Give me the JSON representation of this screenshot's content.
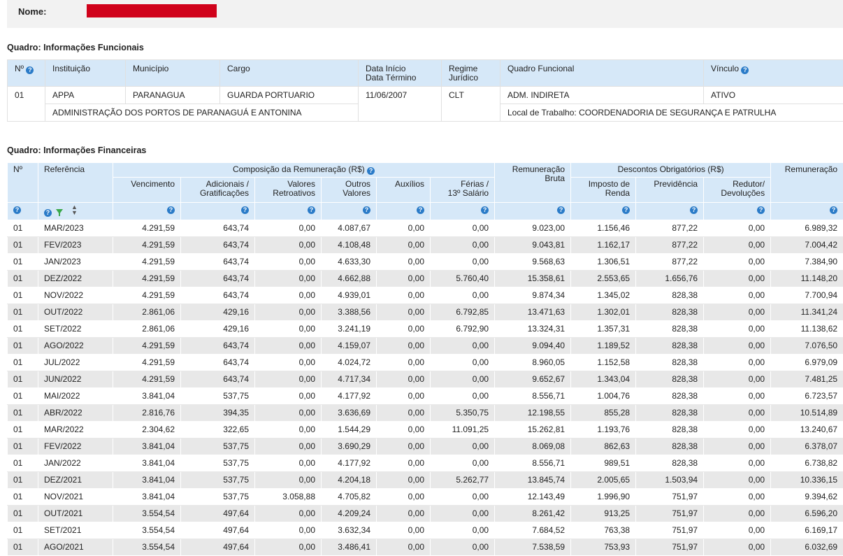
{
  "header": {
    "name_label": "Nome:"
  },
  "funcionais": {
    "title": "Quadro: Informações Funcionais",
    "headers": {
      "num": "Nº",
      "instituicao": "Instituição",
      "municipio": "Município",
      "cargo": "Cargo",
      "data_inicio": "Data Início",
      "data_termino": "Data Término",
      "regime1": "Regime",
      "regime2": "Jurídico",
      "quadro": "Quadro Funcional",
      "vinculo": "Vínculo"
    },
    "row": {
      "num": "01",
      "instituicao": "APPA",
      "municipio": "PARANAGUA",
      "cargo": "GUARDA PORTUARIO",
      "data_inicio": "11/06/2007",
      "regime": "CLT",
      "quadro": "ADM. INDIRETA",
      "vinculo": "ATIVO",
      "instituicao_nome": "ADMINISTRAÇÃO DOS PORTOS DE PARANAGUÁ E ANTONINA",
      "local_trabalho": "Local de Trabalho: COORDENADORIA DE SEGURANÇA E PATRULHA"
    }
  },
  "financeiras": {
    "title": "Quadro: Informações Financeiras",
    "groups": {
      "composicao": "Composição da Remuneração (R$)",
      "descontos": "Descontos Obrigatórios (R$)"
    },
    "headers": {
      "num": "Nº",
      "referencia": "Referência",
      "vencimento": "Vencimento",
      "adicionais1": "Adicionais /",
      "adicionais2": "Gratificações",
      "retroativos1": "Valores",
      "retroativos2": "Retroativos",
      "outros1": "Outros",
      "outros2": "Valores",
      "auxilios": "Auxílios",
      "ferias1": "Férias /",
      "ferias2": "13º Salário",
      "bruta1": "Remuneração",
      "bruta2": "Bruta",
      "imposto1": "Imposto de",
      "imposto2": "Renda",
      "previdencia": "Previdência",
      "redutor1": "Redutor/",
      "redutor2": "Devoluções",
      "remuneracao": "Remuneração"
    },
    "rows": [
      [
        "01",
        "MAR/2023",
        "4.291,59",
        "643,74",
        "0,00",
        "4.087,67",
        "0,00",
        "0,00",
        "9.023,00",
        "1.156,46",
        "877,22",
        "0,00",
        "6.989,32"
      ],
      [
        "01",
        "FEV/2023",
        "4.291,59",
        "643,74",
        "0,00",
        "4.108,48",
        "0,00",
        "0,00",
        "9.043,81",
        "1.162,17",
        "877,22",
        "0,00",
        "7.004,42"
      ],
      [
        "01",
        "JAN/2023",
        "4.291,59",
        "643,74",
        "0,00",
        "4.633,30",
        "0,00",
        "0,00",
        "9.568,63",
        "1.306,51",
        "877,22",
        "0,00",
        "7.384,90"
      ],
      [
        "01",
        "DEZ/2022",
        "4.291,59",
        "643,74",
        "0,00",
        "4.662,88",
        "0,00",
        "5.760,40",
        "15.358,61",
        "2.553,65",
        "1.656,76",
        "0,00",
        "11.148,20"
      ],
      [
        "01",
        "NOV/2022",
        "4.291,59",
        "643,74",
        "0,00",
        "4.939,01",
        "0,00",
        "0,00",
        "9.874,34",
        "1.345,02",
        "828,38",
        "0,00",
        "7.700,94"
      ],
      [
        "01",
        "OUT/2022",
        "2.861,06",
        "429,16",
        "0,00",
        "3.388,56",
        "0,00",
        "6.792,85",
        "13.471,63",
        "1.302,01",
        "828,38",
        "0,00",
        "11.341,24"
      ],
      [
        "01",
        "SET/2022",
        "2.861,06",
        "429,16",
        "0,00",
        "3.241,19",
        "0,00",
        "6.792,90",
        "13.324,31",
        "1.357,31",
        "828,38",
        "0,00",
        "11.138,62"
      ],
      [
        "01",
        "AGO/2022",
        "4.291,59",
        "643,74",
        "0,00",
        "4.159,07",
        "0,00",
        "0,00",
        "9.094,40",
        "1.189,52",
        "828,38",
        "0,00",
        "7.076,50"
      ],
      [
        "01",
        "JUL/2022",
        "4.291,59",
        "643,74",
        "0,00",
        "4.024,72",
        "0,00",
        "0,00",
        "8.960,05",
        "1.152,58",
        "828,38",
        "0,00",
        "6.979,09"
      ],
      [
        "01",
        "JUN/2022",
        "4.291,59",
        "643,74",
        "0,00",
        "4.717,34",
        "0,00",
        "0,00",
        "9.652,67",
        "1.343,04",
        "828,38",
        "0,00",
        "7.481,25"
      ],
      [
        "01",
        "MAI/2022",
        "3.841,04",
        "537,75",
        "0,00",
        "4.177,92",
        "0,00",
        "0,00",
        "8.556,71",
        "1.004,76",
        "828,38",
        "0,00",
        "6.723,57"
      ],
      [
        "01",
        "ABR/2022",
        "2.816,76",
        "394,35",
        "0,00",
        "3.636,69",
        "0,00",
        "5.350,75",
        "12.198,55",
        "855,28",
        "828,38",
        "0,00",
        "10.514,89"
      ],
      [
        "01",
        "MAR/2022",
        "2.304,62",
        "322,65",
        "0,00",
        "1.544,29",
        "0,00",
        "11.091,25",
        "15.262,81",
        "1.193,76",
        "828,38",
        "0,00",
        "13.240,67"
      ],
      [
        "01",
        "FEV/2022",
        "3.841,04",
        "537,75",
        "0,00",
        "3.690,29",
        "0,00",
        "0,00",
        "8.069,08",
        "862,63",
        "828,38",
        "0,00",
        "6.378,07"
      ],
      [
        "01",
        "JAN/2022",
        "3.841,04",
        "537,75",
        "0,00",
        "4.177,92",
        "0,00",
        "0,00",
        "8.556,71",
        "989,51",
        "828,38",
        "0,00",
        "6.738,82"
      ],
      [
        "01",
        "DEZ/2021",
        "3.841,04",
        "537,75",
        "0,00",
        "4.204,18",
        "0,00",
        "5.262,77",
        "13.845,74",
        "2.005,65",
        "1.503,94",
        "0,00",
        "10.336,15"
      ],
      [
        "01",
        "NOV/2021",
        "3.841,04",
        "537,75",
        "3.058,88",
        "4.705,82",
        "0,00",
        "0,00",
        "12.143,49",
        "1.996,90",
        "751,97",
        "0,00",
        "9.394,62"
      ],
      [
        "01",
        "OUT/2021",
        "3.554,54",
        "497,64",
        "0,00",
        "4.209,24",
        "0,00",
        "0,00",
        "8.261,42",
        "913,25",
        "751,97",
        "0,00",
        "6.596,20"
      ],
      [
        "01",
        "SET/2021",
        "3.554,54",
        "497,64",
        "0,00",
        "3.632,34",
        "0,00",
        "0,00",
        "7.684,52",
        "763,38",
        "751,97",
        "0,00",
        "6.169,17"
      ],
      [
        "01",
        "AGO/2021",
        "3.554,54",
        "497,64",
        "0,00",
        "3.486,41",
        "0,00",
        "0,00",
        "7.538,59",
        "753,93",
        "751,97",
        "0,00",
        "6.032,69"
      ]
    ]
  },
  "icons": {
    "help": "help-circle-icon",
    "filter": "filter-icon",
    "sort": "sort-icon"
  },
  "colors": {
    "header_bg": "#d6e8f8",
    "help_icon": "#2a7bc8",
    "filter_icon": "#3aa84a",
    "redaction": "#d0021b",
    "row_alt": "#e8e8e8"
  }
}
